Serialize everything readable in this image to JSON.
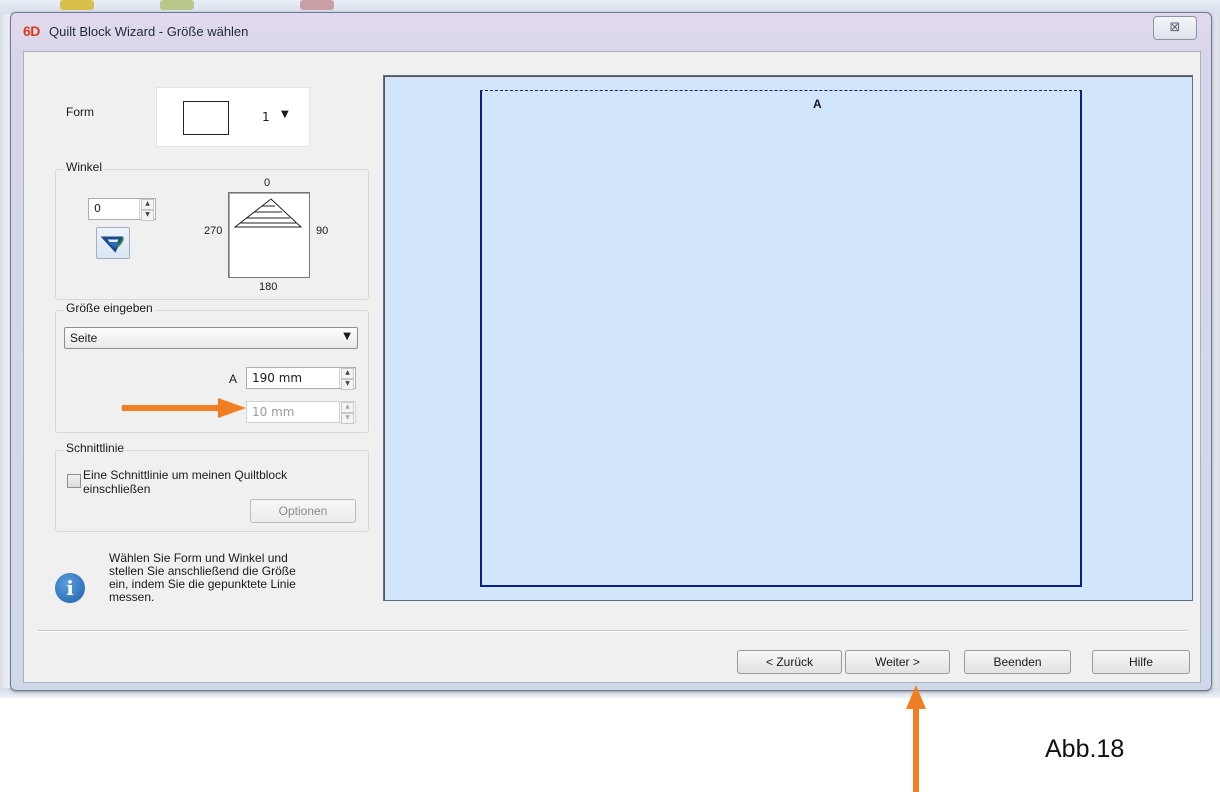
{
  "window": {
    "app_logo": "6D",
    "title": "Quilt Block Wizard - Größe wählen",
    "close_glyph": "⊠"
  },
  "form": {
    "label": "Form",
    "value": "1"
  },
  "angle": {
    "group_title": "Winkel",
    "value": "0",
    "dial_top": "0",
    "dial_right": "90",
    "dial_bottom": "180",
    "dial_left": "270"
  },
  "size": {
    "group_title": "Größe eingeben",
    "mode_select": "Seite",
    "field_a_label": "A",
    "field_a_value": "190 mm",
    "field_b_value": "10 mm"
  },
  "cutline": {
    "group_title": "Schnittlinie",
    "checkbox_label_line1": "Eine Schnittlinie um meinen Quiltblock",
    "checkbox_label_line2": "einschließen",
    "checked": false,
    "options_button": "Optionen"
  },
  "info": {
    "text": "Wählen Sie Form und Winkel und stellen Sie anschließend die Größe ein, indem Sie die gepunktete Linie messen."
  },
  "preview": {
    "edge_label": "A"
  },
  "footer": {
    "back_button": "< Zurück",
    "next_button": "Weiter >",
    "finish_button": "Beenden",
    "help_button": "Hilfe"
  },
  "annotation": {
    "figure_label": "Abb.18",
    "arrow_color": "#f07f23"
  },
  "colors": {
    "preview_background": "#d1e5fb",
    "block_outline": "#0a1f8c",
    "info_icon": "#1f5fa8"
  }
}
